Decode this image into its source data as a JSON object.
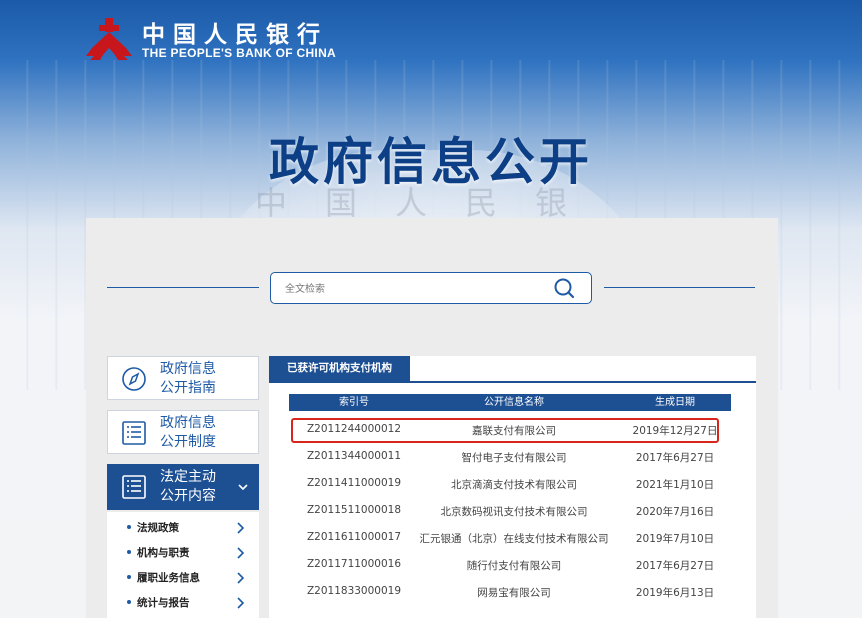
{
  "header": {
    "brand_cn": "中国人民银行",
    "brand_en": "THE PEOPLE'S BANK OF CHINA",
    "watermark": "中国人民银行",
    "page_title": "政府信息公开"
  },
  "search": {
    "placeholder": "全文检索",
    "value": ""
  },
  "sidebar": {
    "cards": [
      {
        "label_line1": "政府信息",
        "label_line2": "公开指南",
        "icon": "compass-icon"
      },
      {
        "label_line1": "政府信息",
        "label_line2": "公开制度",
        "icon": "document-list-icon"
      },
      {
        "label_line1": "法定主动",
        "label_line2": "公开内容",
        "icon": "document-list-icon",
        "active": true
      }
    ],
    "sub_items": [
      {
        "label": "法规政策"
      },
      {
        "label": "机构与职责"
      },
      {
        "label": "履职业务信息"
      },
      {
        "label": "统计与报告"
      }
    ]
  },
  "main": {
    "tab_label": "已获许可机构支付机构",
    "columns": [
      "索引号",
      "公开信息名称",
      "生成日期"
    ],
    "rows": [
      {
        "index": "Z2011244000012",
        "name": "嘉联支付有限公司",
        "date": "2019年12月27日",
        "highlighted": true
      },
      {
        "index": "Z2011344000011",
        "name": "智付电子支付有限公司",
        "date": "2017年6月27日"
      },
      {
        "index": "Z2011411000019",
        "name": "北京滴滴支付技术有限公司",
        "date": "2021年1月10日"
      },
      {
        "index": "Z2011511000018",
        "name": "北京数码视讯支付技术有限公司",
        "date": "2020年7月16日"
      },
      {
        "index": "Z2011611000017",
        "name": "汇元银通（北京）在线支付技术有限公司",
        "date": "2019年7月10日"
      },
      {
        "index": "Z2011711000016",
        "name": "随行付支付有限公司",
        "date": "2017年6月27日"
      },
      {
        "index": "Z2011833000019",
        "name": "网易宝有限公司",
        "date": "2019年6月13日"
      }
    ]
  },
  "colors": {
    "primary": "#1d4f93",
    "highlight": "#d9251c",
    "brand_red": "#c8161d"
  }
}
